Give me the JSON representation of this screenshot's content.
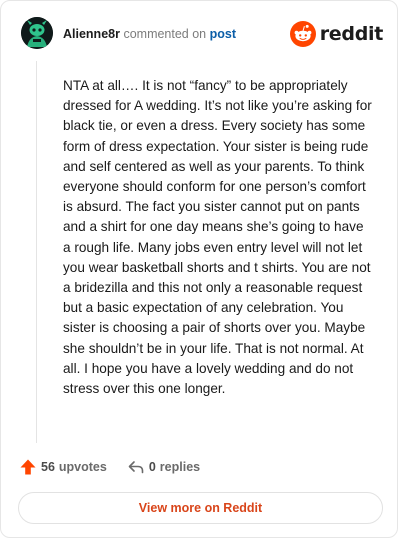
{
  "comment": {
    "author": "Alienne8r",
    "action": "commented on",
    "target": "post",
    "body": "NTA at all…. It is not “fancy” to be appropriately dressed for A wedding. It’s not like you’re asking for black tie, or even a dress. Every society has some form of dress expectation. Your sister is being rude and self centered as well as your parents. To think everyone should conform for one person’s comfort is absurd. The fact you sister cannot put on pants and a shirt for one day means she’s going to have a rough life. Many jobs even entry level will not let you wear basketball shorts and t shirts. You are not a bridezilla and this not only a reasonable request but a basic expectation of any celebration. You sister is choosing a pair of shorts over you. Maybe she shouldn’t be in your life. That is not normal. At all. I hope you have a lovely wedding and do not stress over this one longer.",
    "upvotes_count": "56",
    "upvotes_label": "upvotes",
    "replies_count": "0",
    "replies_label": "replies"
  },
  "brand": {
    "name": "reddit",
    "accent": "#ff4500"
  },
  "footer": {
    "more_label": "View more on Reddit"
  },
  "icons": {
    "avatar": "snoo-avatar-icon",
    "logo": "reddit-logo-icon",
    "upvote": "upvote-arrow-icon",
    "reply": "reply-arrow-icon"
  },
  "colors": {
    "link": "#0b5ea8",
    "button_text": "#d9451a",
    "upvote": "#ff4500"
  }
}
